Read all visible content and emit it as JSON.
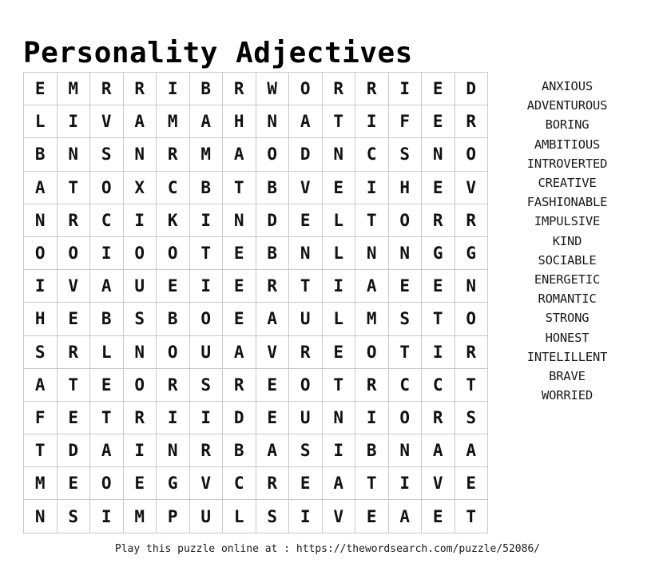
{
  "page": {
    "title": "Personality Adjectives",
    "background_color": "#ffffff",
    "text_color": "#000000",
    "grid_border_color": "#c9c9c9"
  },
  "grid": {
    "rows": 14,
    "columns": 14,
    "letters": [
      [
        "E",
        "M",
        "R",
        "R",
        "I",
        "B",
        "R",
        "W",
        "O",
        "R",
        "R",
        "I",
        "E",
        "D"
      ],
      [
        "L",
        "I",
        "V",
        "A",
        "M",
        "A",
        "H",
        "N",
        "A",
        "T",
        "I",
        "F",
        "E",
        "R"
      ],
      [
        "B",
        "N",
        "S",
        "N",
        "R",
        "M",
        "A",
        "O",
        "D",
        "N",
        "C",
        "S",
        "N",
        "O"
      ],
      [
        "A",
        "T",
        "O",
        "X",
        "C",
        "B",
        "T",
        "B",
        "V",
        "E",
        "I",
        "H",
        "E",
        "V"
      ],
      [
        "N",
        "R",
        "C",
        "I",
        "K",
        "I",
        "N",
        "D",
        "E",
        "L",
        "T",
        "O",
        "R",
        "R"
      ],
      [
        "O",
        "O",
        "I",
        "O",
        "O",
        "T",
        "E",
        "B",
        "N",
        "L",
        "N",
        "N",
        "G",
        "G"
      ],
      [
        "I",
        "V",
        "A",
        "U",
        "E",
        "I",
        "E",
        "R",
        "T",
        "I",
        "A",
        "E",
        "E",
        "N"
      ],
      [
        "H",
        "E",
        "B",
        "S",
        "B",
        "O",
        "E",
        "A",
        "U",
        "L",
        "M",
        "S",
        "T",
        "O"
      ],
      [
        "S",
        "R",
        "L",
        "N",
        "O",
        "U",
        "A",
        "V",
        "R",
        "E",
        "O",
        "T",
        "I",
        "R"
      ],
      [
        "A",
        "T",
        "E",
        "O",
        "R",
        "S",
        "R",
        "E",
        "O",
        "T",
        "R",
        "C",
        "C",
        "T"
      ],
      [
        "F",
        "E",
        "T",
        "R",
        "I",
        "I",
        "D",
        "E",
        "U",
        "N",
        "I",
        "O",
        "R",
        "S"
      ],
      [
        "T",
        "D",
        "A",
        "I",
        "N",
        "R",
        "B",
        "A",
        "S",
        "I",
        "B",
        "N",
        "A",
        "A"
      ],
      [
        "M",
        "E",
        "O",
        "E",
        "G",
        "V",
        "C",
        "R",
        "E",
        "A",
        "T",
        "I",
        "V",
        "E"
      ],
      [
        "N",
        "S",
        "I",
        "M",
        "P",
        "U",
        "L",
        "S",
        "I",
        "V",
        "E",
        "A",
        "E",
        "T"
      ]
    ]
  },
  "word_list": {
    "words": [
      "ANXIOUS",
      "ADVENTUROUS",
      "BORING",
      "AMBITIOUS",
      "INTROVERTED",
      "CREATIVE",
      "FASHIONABLE",
      "IMPULSIVE",
      "KIND",
      "SOCIABLE",
      "ENERGETIC",
      "ROMANTIC",
      "STRONG",
      "HONEST",
      "INTELILLENT",
      "BRAVE",
      "WORRIED"
    ]
  },
  "footer": {
    "text": "Play this puzzle online at : https://thewordsearch.com/puzzle/52086/"
  }
}
